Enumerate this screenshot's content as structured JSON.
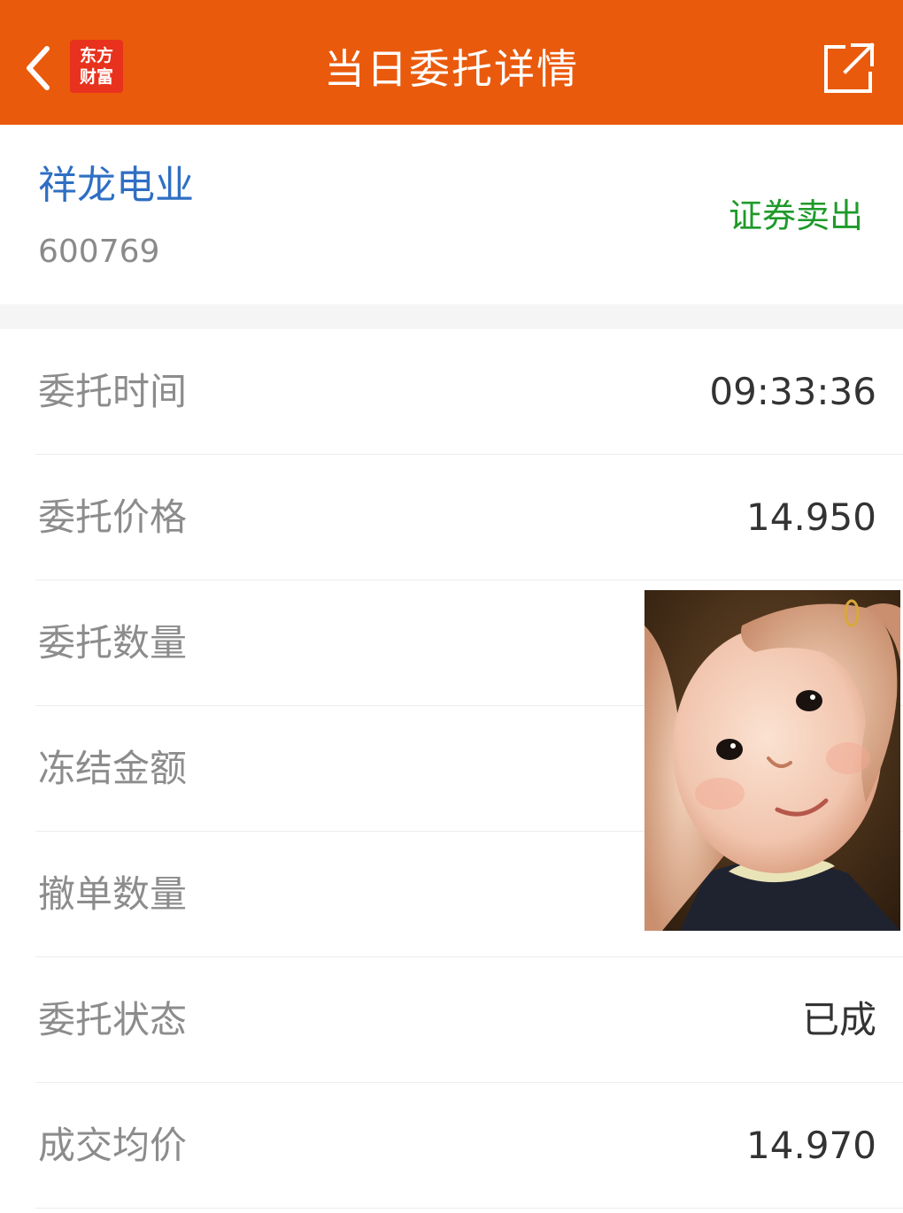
{
  "header": {
    "title": "当日委托详情",
    "logo_line1": "东方",
    "logo_line2": "财富"
  },
  "stock": {
    "name": "祥龙电业",
    "code": "600769",
    "trade_type": "证券卖出"
  },
  "rows": [
    {
      "label": "委托时间",
      "value": "09:33:36"
    },
    {
      "label": "委托价格",
      "value": "14.950"
    },
    {
      "label": "委托数量",
      "value": ""
    },
    {
      "label": "冻结金额",
      "value": ""
    },
    {
      "label": "撤单数量",
      "value": ""
    },
    {
      "label": "委托状态",
      "value": "已成"
    },
    {
      "label": "成交均价",
      "value": "14.970"
    }
  ],
  "colors": {
    "header_bg": "#ea5a0c",
    "logo_bg": "#e8321d",
    "stock_name": "#2f6fc4",
    "trade_type": "#1e9a2a"
  },
  "icons": {
    "back": "chevron-left-icon",
    "share": "share-external-icon"
  }
}
